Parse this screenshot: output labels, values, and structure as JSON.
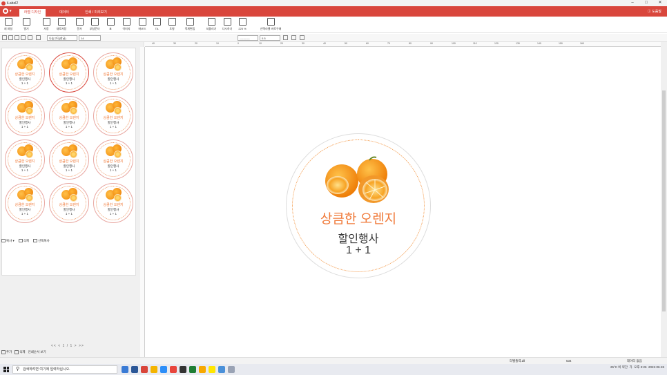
{
  "window": {
    "title": "iLabel2",
    "controls": [
      "–",
      "□",
      "✕"
    ]
  },
  "ribbon": {
    "tabs": [
      {
        "label": "라벨 디자인",
        "active": true
      },
      {
        "label": "데이터",
        "active": false
      },
      {
        "label": "인쇄 / 미리보기",
        "active": false
      }
    ],
    "help_label": "ⓘ 도움말"
  },
  "toolbar": {
    "items": [
      {
        "label": "새 파일",
        "icon": "new-file-icon"
      },
      {
        "label": "열기",
        "icon": "open-folder-icon"
      },
      {
        "label": "저장",
        "icon": "save-icon"
      },
      {
        "label": "새로저장",
        "icon": "save-as-icon"
      },
      {
        "label": "문자",
        "icon": "text-icon"
      },
      {
        "label": "부침문자",
        "icon": "text-effect-icon"
      },
      {
        "label": "표",
        "icon": "table-icon"
      },
      {
        "label": "이미지",
        "icon": "image-icon"
      },
      {
        "label": "바코드",
        "icon": "barcode-icon"
      },
      {
        "label": "TA",
        "icon": "textarea-icon"
      },
      {
        "label": "도형",
        "icon": "shape-icon"
      },
      {
        "label": "객체편집",
        "icon": "object-edit-icon"
      },
      {
        "label": "되돌리기",
        "icon": "undo-icon"
      },
      {
        "label": "다시하기",
        "icon": "redo-icon"
      },
      {
        "label": "225 %",
        "icon": "zoom-icon"
      },
      {
        "label": "선택라벨 바로구매",
        "icon": "basket-icon"
      }
    ]
  },
  "format_bar": {
    "font_name": "나눔고딕(한글)",
    "font_size": "14",
    "line_style": "-----------",
    "line_width": "0.5"
  },
  "ruler": {
    "ticks": [
      "40",
      "30",
      "20",
      "10",
      "0",
      "10",
      "20",
      "30",
      "40",
      "50",
      "60",
      "70",
      "80",
      "90",
      "100",
      "110",
      "120",
      "130",
      "140",
      "150",
      "160"
    ]
  },
  "thumbnail_label": {
    "title": "상큼한 오렌지",
    "subtitle": "할인행사",
    "offer": "1 + 1"
  },
  "panel_actions": {
    "copy": "복사",
    "delete": "삭제",
    "copy_selected": "선택복사"
  },
  "pager": {
    "first": "<<",
    "prev": "<",
    "page": "1 / 1",
    "next": ">",
    "last": ">>"
  },
  "left_footer": {
    "add": "추가",
    "delete": "삭제",
    "show_order": "인쇄순서 보기"
  },
  "label": {
    "title": "상큼한 오렌지",
    "subtitle": "할인행사",
    "offer": "1 + 1"
  },
  "status": {
    "printer": "라벨출력.dll",
    "count": "534",
    "data": "데이터 없음"
  },
  "taskbar": {
    "search_placeholder": "검색하려면 여기에 입력하십시오.",
    "weather": "25°C 비 약간",
    "ime": "가",
    "time": "오후 3:26",
    "date": "2022-06-26"
  },
  "colors": {
    "ribbon": "#d9463c",
    "label_title": "#f07a3a",
    "orange": "#f18a0c"
  }
}
